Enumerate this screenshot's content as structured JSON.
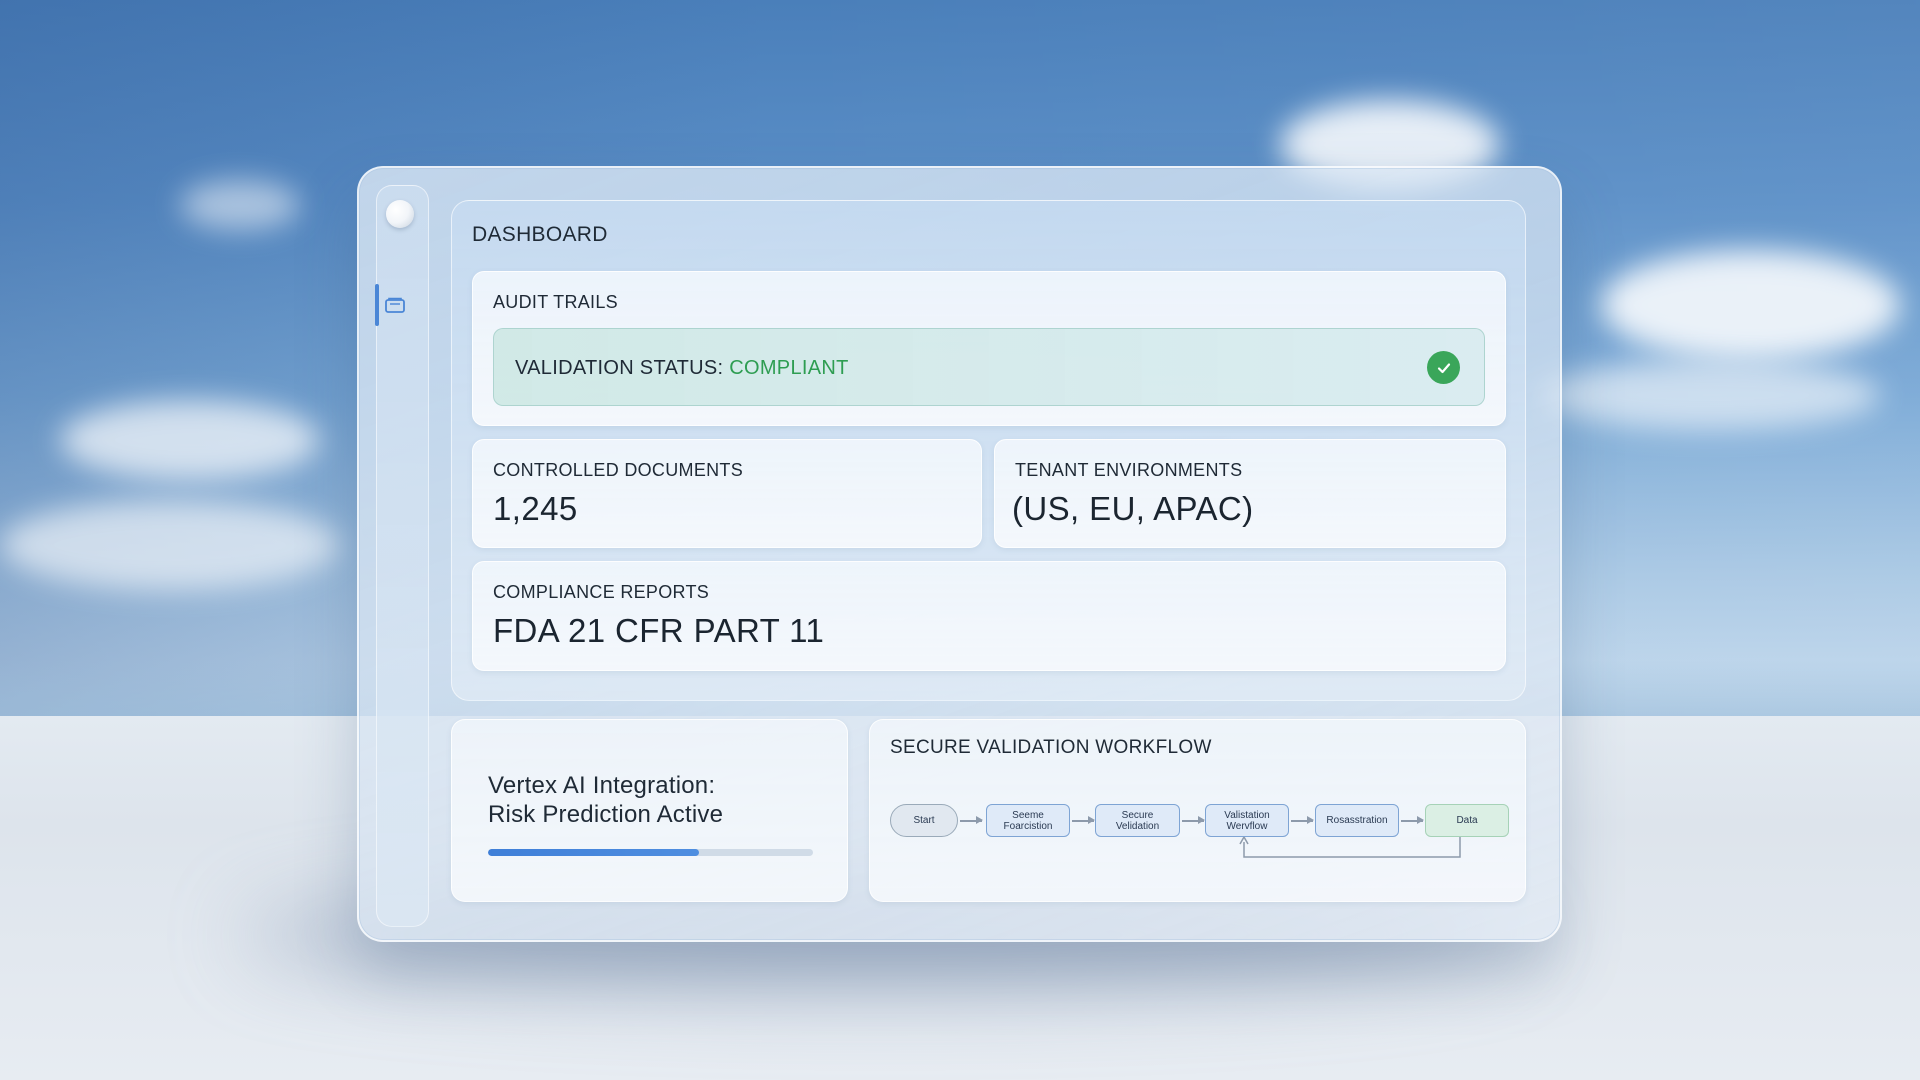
{
  "dashboard": {
    "title": "DASHBOARD"
  },
  "sidebar": {
    "items": [
      {
        "icon": "folder-icon",
        "active": true
      }
    ]
  },
  "audit": {
    "label": "AUDIT TRAILS",
    "status_prefix": "VALIDATION STATUS: ",
    "status_value": "COMPLIANT",
    "status_color": "#2e9d52",
    "status_icon": "check-icon"
  },
  "controlled_documents": {
    "label": "CONTROLLED DOCUMENTS",
    "value": "1,245"
  },
  "tenant_environments": {
    "label": "TENANT ENVIRONMENTS",
    "value": "(US, EU, APAC)"
  },
  "compliance_reports": {
    "label": "COMPLIANCE REPORTS",
    "value": "FDA 21 CFR PART 11"
  },
  "vertex": {
    "line1": "Vertex AI Integration:",
    "line2": "Risk Prediction Active",
    "progress": 0.65,
    "progress_color": "#3f7fd8"
  },
  "workflow": {
    "title": "SECURE VALIDATION WORKFLOW",
    "nodes": [
      {
        "line1": "Start",
        "line2": ""
      },
      {
        "line1": "Seeme",
        "line2": "Foarcistion"
      },
      {
        "line1": "Secure",
        "line2": "Velidation"
      },
      {
        "line1": "Valistation",
        "line2": "Wervflow"
      },
      {
        "line1": "Rosasstration",
        "line2": ""
      },
      {
        "line1": "Data",
        "line2": ""
      }
    ]
  },
  "colors": {
    "accent": "#4a86d6",
    "success": "#3aa65a"
  }
}
